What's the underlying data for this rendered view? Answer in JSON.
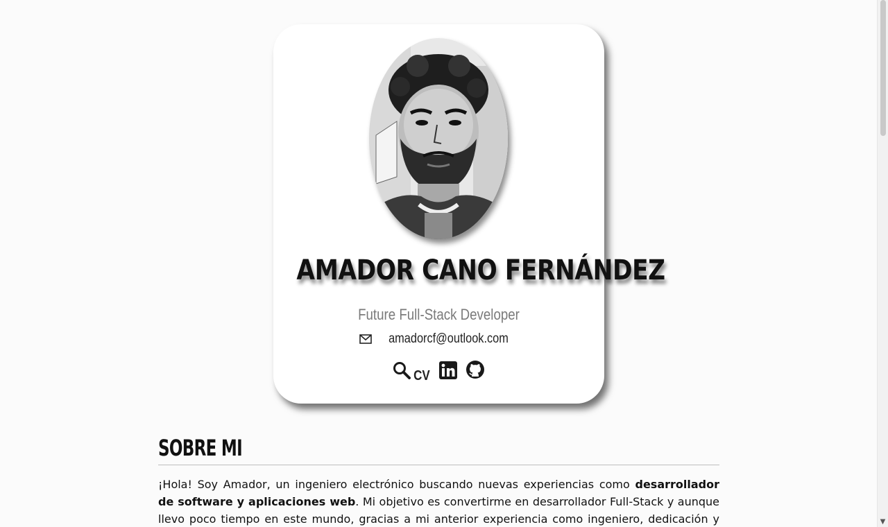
{
  "profile": {
    "name": "AMADOR CANO FERNÁNDEZ",
    "role": "Future Full-Stack Developer",
    "email": "amadorcf@outlook.com",
    "cv_label": "CV",
    "links": [
      {
        "name": "cv",
        "icon": "search-icon"
      },
      {
        "name": "linkedin",
        "icon": "linkedin-icon"
      },
      {
        "name": "github",
        "icon": "github-icon"
      }
    ]
  },
  "about": {
    "title": "SOBRE MI",
    "text_1": "¡Hola! Soy Amador, un ingeniero electrónico buscando nuevas experiencias como ",
    "text_bold": "desarrollador de software y aplicaciones web",
    "text_2": ". Mi objetivo es convertirme en desarrollador Full-Stack y aunque llevo poco tiempo en este mundo, gracias a mi anterior experiencia como ingeniero, dedicación y ganas"
  },
  "colors": {
    "background": "#fbfbfb",
    "card": "#ffffff",
    "role_text": "#7a7a7a"
  }
}
